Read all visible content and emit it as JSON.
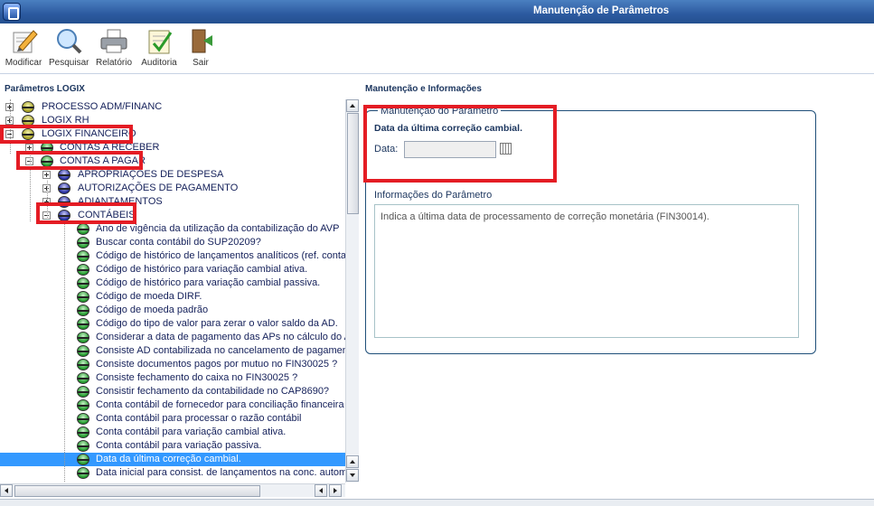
{
  "window": {
    "title": "Manutenção de Parâmetros"
  },
  "toolbar": {
    "buttons": [
      {
        "label": "Modificar",
        "icon": "pencil-edit-icon"
      },
      {
        "label": "Pesquisar",
        "icon": "magnifier-icon"
      },
      {
        "label": "Relatório",
        "icon": "printer-icon"
      },
      {
        "label": "Auditoria",
        "icon": "checklist-icon"
      },
      {
        "label": "Sair",
        "icon": "exit-door-icon"
      }
    ]
  },
  "left_panel": {
    "title": "Parâmetros LOGIX",
    "tree": [
      {
        "label": "PROCESSO ADM/FINANC",
        "level": 0,
        "expander": "plus",
        "icon": "olive"
      },
      {
        "label": "LOGIX RH",
        "level": 0,
        "expander": "plus",
        "icon": "olive"
      },
      {
        "label": "LOGIX FINANCEIRO",
        "level": 0,
        "expander": "minus",
        "icon": "olive"
      },
      {
        "label": "CONTAS A RECEBER",
        "level": 1,
        "expander": "plus",
        "icon": "green"
      },
      {
        "label": "CONTAS A PAGAR",
        "level": 1,
        "expander": "minus",
        "icon": "green"
      },
      {
        "label": "APROPRIAÇÕES DE DESPESA",
        "level": 2,
        "expander": "plus",
        "icon": "blue"
      },
      {
        "label": "AUTORIZAÇÕES DE PAGAMENTO",
        "level": 2,
        "expander": "plus",
        "icon": "blue"
      },
      {
        "label": "ADIANTAMENTOS",
        "level": 2,
        "expander": "plus",
        "icon": "blue"
      },
      {
        "label": "CONTÁBEIS",
        "level": 2,
        "expander": "minus",
        "icon": "blue"
      },
      {
        "label": "Ano de vigência da utilização da contabilização do AVP",
        "level": 3,
        "icon": "green"
      },
      {
        "label": "Buscar conta contábil do SUP20209?",
        "level": 3,
        "icon": "green"
      },
      {
        "label": "Código de histórico de lançamentos analíticos (ref. contas",
        "level": 3,
        "icon": "green"
      },
      {
        "label": "Código de histórico para variação cambial ativa.",
        "level": 3,
        "icon": "green"
      },
      {
        "label": "Código de histórico para variação cambial passiva.",
        "level": 3,
        "icon": "green"
      },
      {
        "label": "Código de moeda DIRF.",
        "level": 3,
        "icon": "green"
      },
      {
        "label": "Código de moeda padrão",
        "level": 3,
        "icon": "green"
      },
      {
        "label": "Código do tipo de valor para zerar o valor saldo da AD.",
        "level": 3,
        "icon": "green"
      },
      {
        "label": "Considerar a data de pagamento das APs no cálculo do A",
        "level": 3,
        "icon": "green"
      },
      {
        "label": "Consiste AD contabilizada no cancelamento de pagament",
        "level": 3,
        "icon": "green"
      },
      {
        "label": "Consiste documentos pagos por mutuo no FIN30025 ?",
        "level": 3,
        "icon": "green"
      },
      {
        "label": "Consiste fechamento do caixa no FIN30025 ?",
        "level": 3,
        "icon": "green"
      },
      {
        "label": "Consistir fechamento da contabilidade no CAP8690?",
        "level": 3,
        "icon": "green"
      },
      {
        "label": "Conta contábil de fornecedor para conciliação financeira",
        "level": 3,
        "icon": "green"
      },
      {
        "label": "Conta contábil para processar o razão contábil",
        "level": 3,
        "icon": "green"
      },
      {
        "label": "Conta contábil para variação cambial ativa.",
        "level": 3,
        "icon": "green"
      },
      {
        "label": "Conta contábil para variação passiva.",
        "level": 3,
        "icon": "green"
      },
      {
        "label": "Data da última correção cambial.",
        "level": 3,
        "icon": "green",
        "selected": true
      },
      {
        "label": "Data inicial para consist. de lançamentos na conc. autom",
        "level": 3,
        "icon": "green"
      }
    ]
  },
  "right_panel": {
    "title": "Manutenção e Informações",
    "group_legend": "Manutenção do Parâmetro",
    "parameter_title": "Data da última correção cambial.",
    "field_label": "Data:",
    "field_value": "",
    "info_label": "Informações do Parâmetro",
    "info_text": "Indica a última data de processamento de correção monetária (FIN30014)."
  },
  "colors": {
    "highlight": "#e41c24",
    "selection": "#3399ff",
    "titlebar": "#2c5aa0"
  }
}
